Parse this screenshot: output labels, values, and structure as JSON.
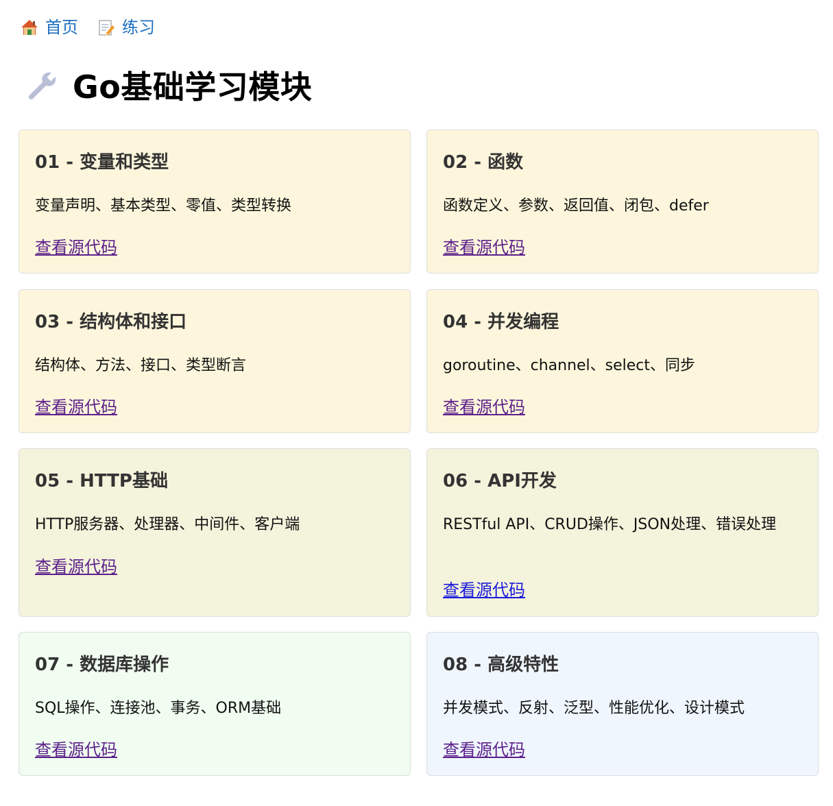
{
  "breadcrumb": [
    {
      "label": "首页",
      "icon": "house-icon"
    },
    {
      "label": "练习",
      "icon": "memo-icon"
    }
  ],
  "title": {
    "text": "Go基础学习模块",
    "icon": "wrench-icon"
  },
  "cards": [
    {
      "title": "01 - 变量和类型",
      "description": "变量声明、基本类型、零值、类型转换",
      "link": "查看源代码",
      "background": "#fdf6dc"
    },
    {
      "title": "02 - 函数",
      "description": "函数定义、参数、返回值、闭包、defer",
      "link": "查看源代码",
      "background": "#fdf6dc"
    },
    {
      "title": "03 - 结构体和接口",
      "description": "结构体、方法、接口、类型断言",
      "link": "查看源代码",
      "background": "#fdf6dc"
    },
    {
      "title": "04 - 并发编程",
      "description": "goroutine、channel、select、同步",
      "link": "查看源代码",
      "background": "#fdf6dc"
    },
    {
      "title": "05 - HTTP基础",
      "description": "HTTP服务器、处理器、中间件、客户端",
      "link": "查看源代码",
      "background": "#f4f3dc"
    },
    {
      "title": "06 - API开发",
      "description": "RESTful API、CRUD操作、JSON处理、错误处理",
      "link": "查看源代码",
      "background": "#f4f3dc"
    },
    {
      "title": "07 - 数据库操作",
      "description": "SQL操作、连接池、事务、ORM基础",
      "link": "查看源代码",
      "background": "#f0fdf0"
    },
    {
      "title": "08 - 高级特性",
      "description": "并发模式、反射、泛型、性能优化、设计模式",
      "link": "查看源代码",
      "background": "#eff6fe"
    }
  ],
  "colors": {
    "breadcrumb_link": "#1f6fbf",
    "visited_link": "#5b1f8a",
    "unvisited_link": "#1a1adb",
    "card_border": "#dedede"
  }
}
